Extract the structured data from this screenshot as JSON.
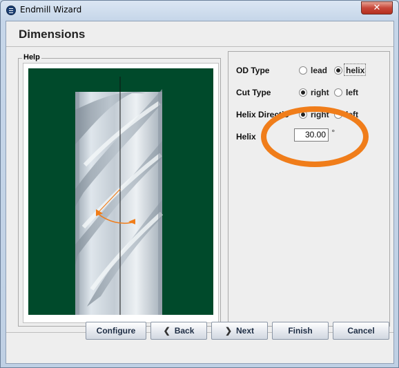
{
  "window": {
    "title": "Endmill Wizard",
    "close_symbol": "✕"
  },
  "page": {
    "title": "Dimensions"
  },
  "help": {
    "legend": "Help"
  },
  "form": {
    "od_type": {
      "label": "OD Type",
      "options": [
        "lead",
        "helix"
      ],
      "selected": "helix"
    },
    "cut_type": {
      "label": "Cut Type",
      "options": [
        "right",
        "left"
      ],
      "selected": "right"
    },
    "helix_direction": {
      "label": "Helix Directio",
      "options": [
        "right",
        "left"
      ],
      "selected": "right"
    },
    "helix": {
      "label": "Helix",
      "value": "30.00",
      "unit": "°"
    }
  },
  "buttons": {
    "configure": "Configure",
    "back": "Back",
    "next": "Next",
    "finish": "Finish",
    "cancel": "Cancel"
  },
  "colors": {
    "help_background": "#004a2b",
    "annotation": "#f07d1a",
    "highlight_ring": "#f07d1a"
  }
}
